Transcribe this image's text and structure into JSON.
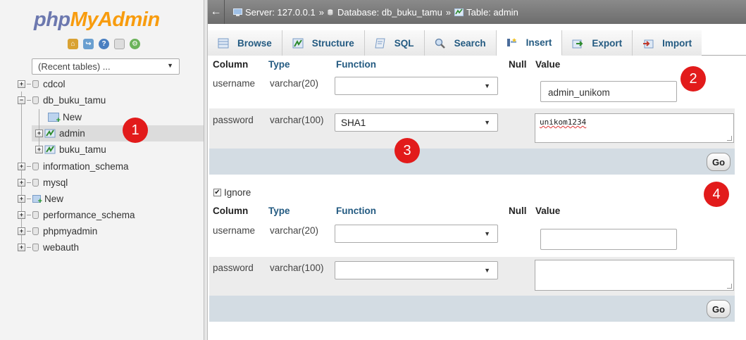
{
  "nav": {
    "logo_part1": "php",
    "logo_part2": "MyAdmin",
    "recent_tables": "(Recent tables) ...",
    "tree": {
      "cdcol": "cdcol",
      "db_buku_tamu": "db_buku_tamu",
      "new_table": "New",
      "admin": "admin",
      "buku_tamu": "buku_tamu",
      "information_schema": "information_schema",
      "mysql": "mysql",
      "new_db": "New",
      "performance_schema": "performance_schema",
      "phpmyadmin": "phpmyadmin",
      "webauth": "webauth"
    }
  },
  "breadcrumb": {
    "server": "Server: 127.0.0.1",
    "sep1": "»",
    "database": "Database: db_buku_tamu",
    "sep2": "»",
    "table": "Table: admin"
  },
  "tabs": [
    {
      "label": "Browse",
      "active": false
    },
    {
      "label": "Structure",
      "active": false
    },
    {
      "label": "SQL",
      "active": false
    },
    {
      "label": "Search",
      "active": false
    },
    {
      "label": "Insert",
      "active": true
    },
    {
      "label": "Export",
      "active": false
    },
    {
      "label": "Import",
      "active": false
    }
  ],
  "headers": {
    "column": "Column",
    "type": "Type",
    "function": "Function",
    "null": "Null",
    "value": "Value"
  },
  "form1": {
    "row1": {
      "column": "username",
      "type": "varchar(20)",
      "function": "",
      "value": "admin_unikom"
    },
    "row2": {
      "column": "password",
      "type": "varchar(100)",
      "function": "SHA1",
      "value": "unikom1234"
    },
    "go": "Go"
  },
  "ignore_label": "Ignore",
  "form2": {
    "row1": {
      "column": "username",
      "type": "varchar(20)",
      "function": "",
      "value": ""
    },
    "row2": {
      "column": "password",
      "type": "varchar(100)",
      "function": "",
      "value": ""
    },
    "go": "Go"
  },
  "badges": [
    "1",
    "2",
    "3",
    "4"
  ],
  "colors": {
    "accent": "#235a81",
    "badge": "#e21b1b",
    "logo_orange": "#f89c0e",
    "logo_blue": "#6c78af"
  }
}
